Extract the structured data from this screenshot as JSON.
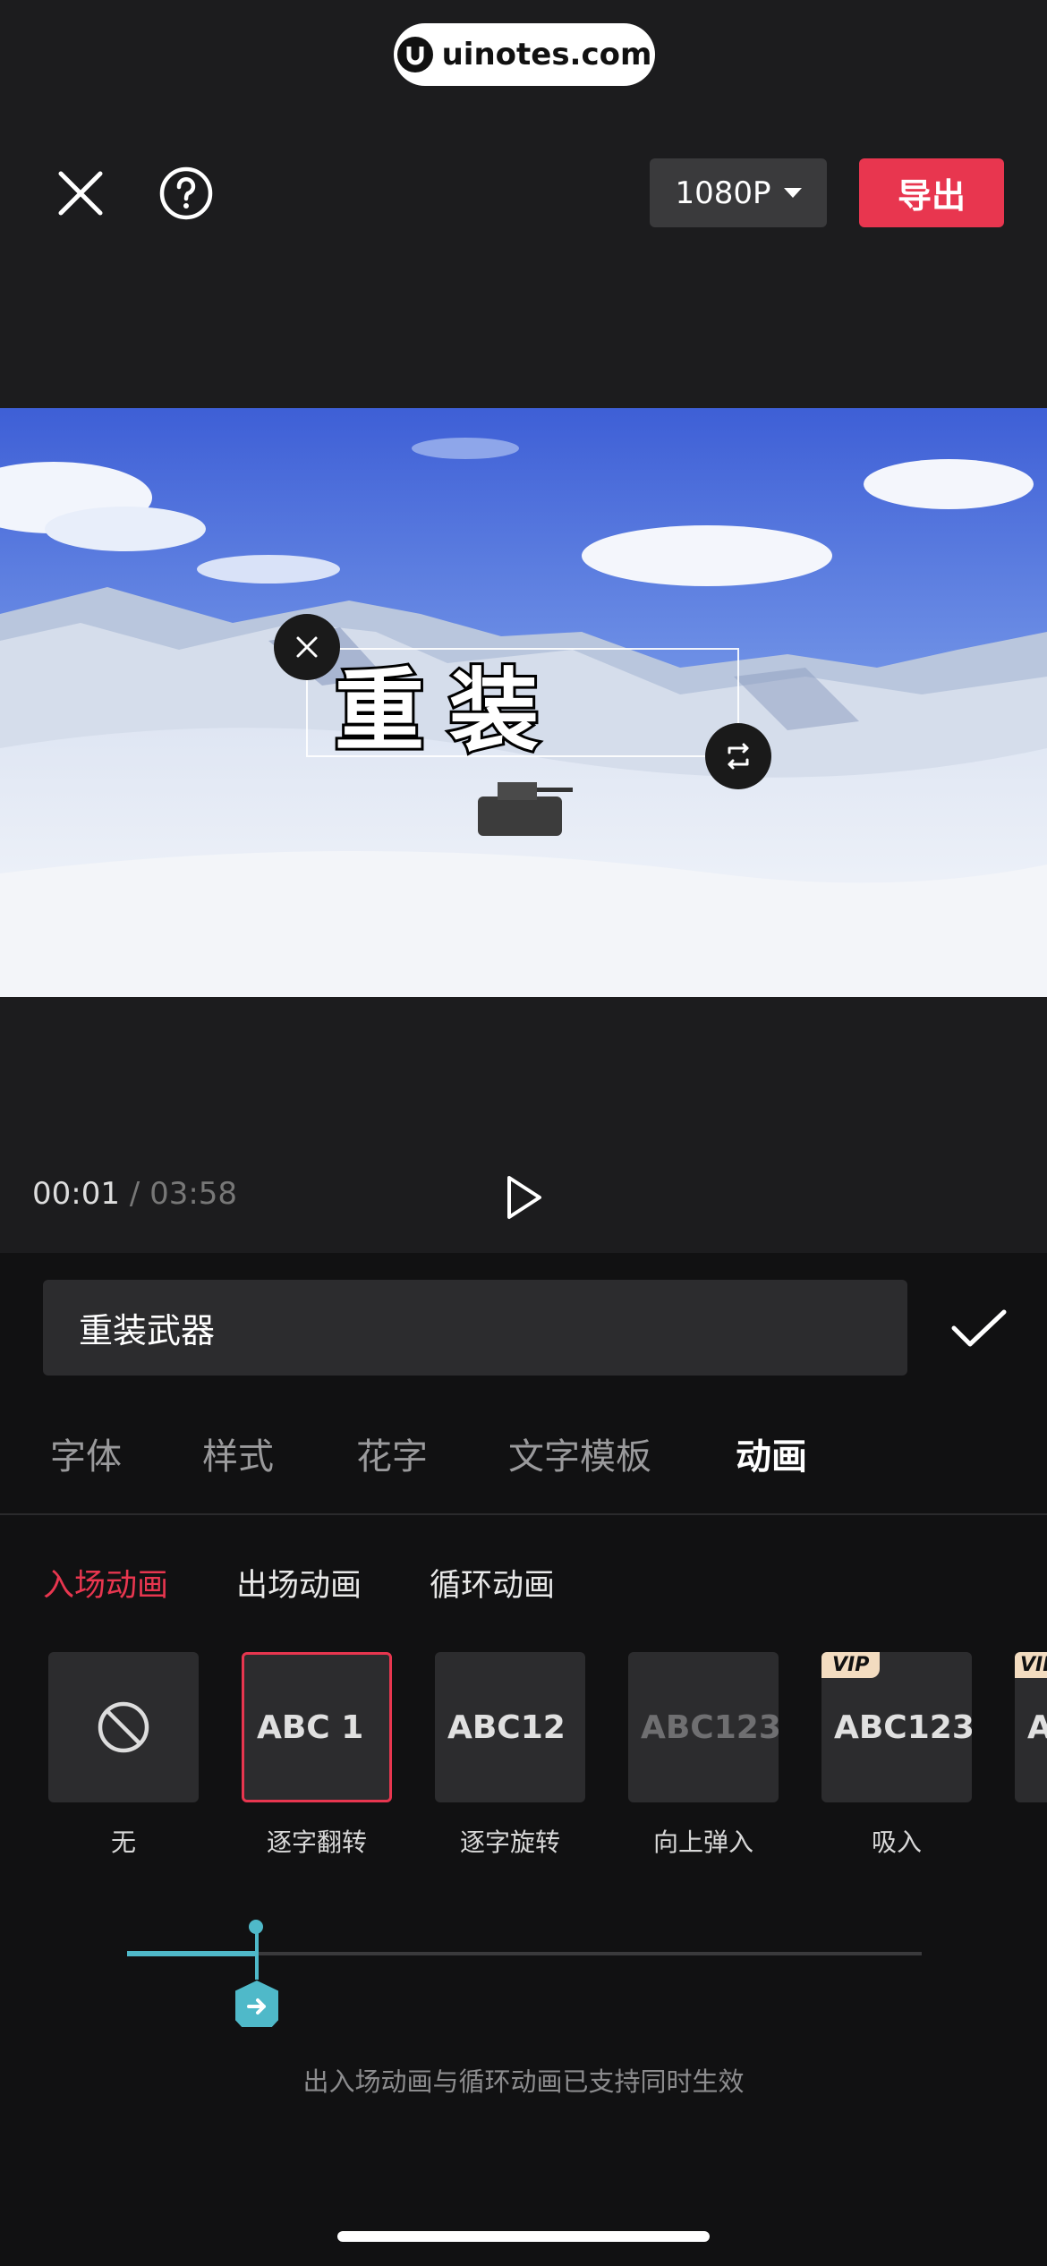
{
  "watermark": {
    "text": "uinotes.com"
  },
  "header": {
    "close_icon": "close-icon",
    "help_icon": "help-icon",
    "resolution": "1080P",
    "export_label": "导出"
  },
  "preview": {
    "text_overlay": "重装",
    "current_time": "00:01",
    "separator": "/",
    "total_time": "03:58"
  },
  "editor": {
    "input_value": "重装武器",
    "tabs": [
      "字体",
      "样式",
      "花字",
      "文字模板",
      "动画"
    ],
    "active_tab": "动画",
    "subtabs": [
      "入场动画",
      "出场动画",
      "循环动画"
    ],
    "active_subtab": "入场动画",
    "animations": [
      {
        "preview": "",
        "label": "无"
      },
      {
        "preview": "ABC 1",
        "label": "逐字翻转"
      },
      {
        "preview": "ABC12",
        "label": "逐字旋转"
      },
      {
        "preview": "ABC123",
        "label": "向上弹入"
      },
      {
        "preview": "ABC123",
        "label": "吸入",
        "badge": "VIP"
      },
      {
        "preview": "A",
        "label": "",
        "badge": "VIP"
      }
    ],
    "selected_animation": "逐字翻转",
    "duration_progress": 0.16,
    "hint": "出入场动画与循环动画已支持同时生效"
  },
  "colors": {
    "accent": "#e8364f",
    "slider": "#4fb9c9",
    "background": "#111112"
  }
}
